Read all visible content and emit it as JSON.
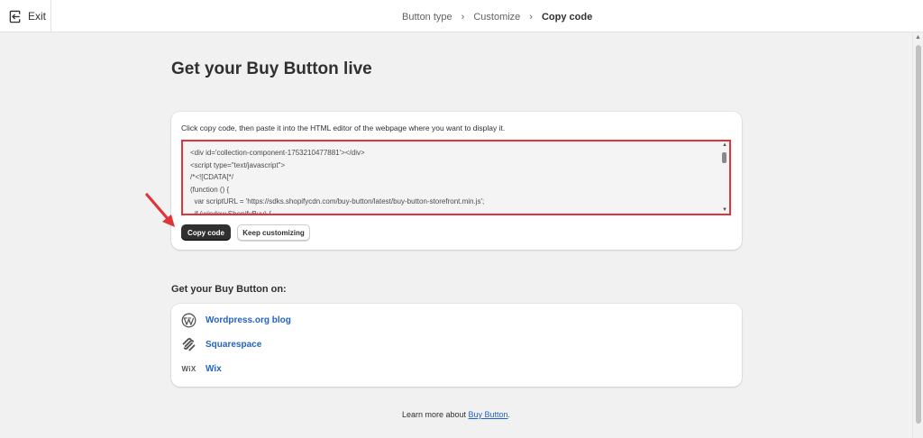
{
  "topbar": {
    "exit_label": "Exit",
    "breadcrumb": [
      {
        "label": "Button type",
        "current": false
      },
      {
        "label": "Customize",
        "current": false
      },
      {
        "label": "Copy code",
        "current": true
      }
    ]
  },
  "main": {
    "title": "Get your Buy Button live",
    "code_card": {
      "instruction": "Click copy code, then paste it into the HTML editor of the webpage where you want to display it.",
      "code": "<div id='collection-component-1753210477881'></div>\n<script type=\"text/javascript\">\n/*<![CDATA[*/\n(function () {\n  var scriptURL = 'https://sdks.shopifycdn.com/buy-button/latest/buy-button-storefront.min.js';\n  if (window.ShopifyBuy) {",
      "copy_button": "Copy code",
      "keep_button": "Keep customizing"
    },
    "platforms_heading": "Get your Buy Button on:",
    "platforms": [
      {
        "icon": "wordpress-icon",
        "label": "Wordpress.org blog"
      },
      {
        "icon": "squarespace-icon",
        "label": "Squarespace"
      },
      {
        "icon": "wix-icon",
        "icon_text": "WiX",
        "label": "Wix"
      }
    ],
    "footer": {
      "prefix": "Learn more about ",
      "link": "Buy Button",
      "suffix": "."
    }
  },
  "colors": {
    "accent_link": "#2463c4",
    "highlight_border": "#e0343a",
    "primary_button": "#303030",
    "background": "#f1f1f1"
  }
}
